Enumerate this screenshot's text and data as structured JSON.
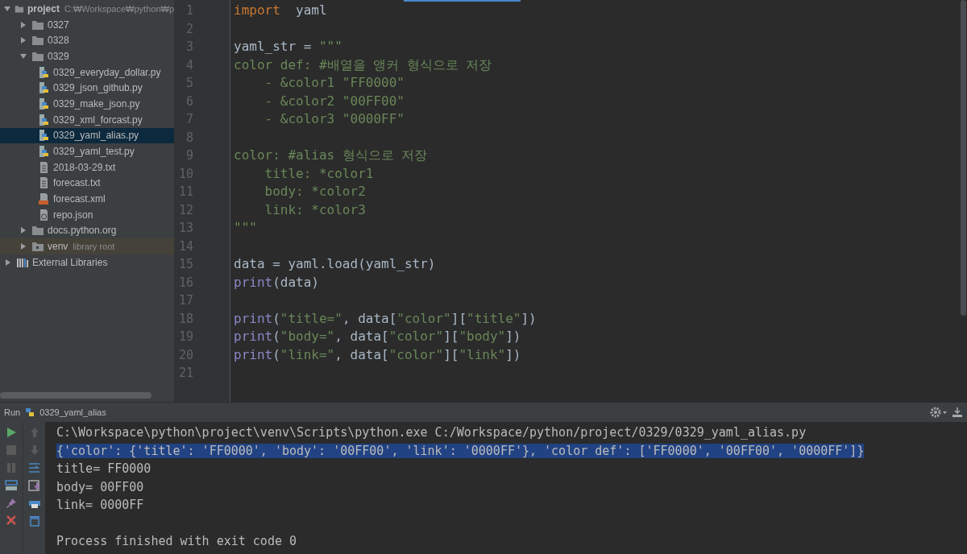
{
  "project_tree": [
    {
      "label": "project",
      "hint": "C:₩Workspace₩python₩p",
      "kind": "folder",
      "expanded": true,
      "selected": false,
      "children": [
        {
          "label": "0327",
          "kind": "folder",
          "expanded": false,
          "selected": false
        },
        {
          "label": "0328",
          "kind": "folder",
          "expanded": false,
          "selected": false
        },
        {
          "label": "0329",
          "kind": "folder",
          "expanded": true,
          "selected": false,
          "children": [
            {
              "label": "0329_everyday_dollar.py",
              "kind": "python",
              "selected": false
            },
            {
              "label": "0329_json_github.py",
              "kind": "python",
              "selected": false
            },
            {
              "label": "0329_make_json.py",
              "kind": "python",
              "selected": false
            },
            {
              "label": "0329_xml_forcast.py",
              "kind": "python",
              "selected": false
            },
            {
              "label": "0329_yaml_alias.py",
              "kind": "python",
              "selected": true
            },
            {
              "label": "0329_yaml_test.py",
              "kind": "python",
              "selected": false
            },
            {
              "label": "2018-03-29.txt",
              "kind": "text",
              "selected": false
            },
            {
              "label": "forecast.txt",
              "kind": "text",
              "selected": false
            },
            {
              "label": "forecast.xml",
              "kind": "xml",
              "selected": false
            },
            {
              "label": "repo.json",
              "kind": "json",
              "selected": false
            }
          ]
        },
        {
          "label": "docs.python.org",
          "kind": "folder",
          "expanded": false,
          "selected": false
        },
        {
          "label": "venv",
          "hint": "library root",
          "kind": "venv",
          "expanded": false,
          "selected": false
        }
      ]
    },
    {
      "label": "External Libraries",
      "kind": "libraries",
      "expanded": false,
      "selected": false
    }
  ],
  "editor": {
    "lines": [
      {
        "number": "1",
        "segments": [
          {
            "kind": "keyword",
            "text": "import"
          },
          {
            "kind": "plain",
            "text": "  yaml"
          }
        ]
      },
      {
        "number": "2"
      },
      {
        "number": "3",
        "segments": [
          {
            "kind": "plain",
            "text": "yaml_str = "
          },
          {
            "kind": "string",
            "text": "\"\"\""
          }
        ]
      },
      {
        "number": "4",
        "segments": [
          {
            "kind": "string",
            "text": "color def: #배열을 앵커 형식으로 저장"
          }
        ]
      },
      {
        "number": "5",
        "segments": [
          {
            "kind": "string",
            "text": "    - &color1 \"FF0000\""
          }
        ]
      },
      {
        "number": "6",
        "segments": [
          {
            "kind": "string",
            "text": "    - &color2 \"00FF00\""
          }
        ]
      },
      {
        "number": "7",
        "segments": [
          {
            "kind": "string",
            "text": "    - &color3 \"0000FF\""
          }
        ]
      },
      {
        "number": "8"
      },
      {
        "number": "9",
        "segments": [
          {
            "kind": "string",
            "text": "color: #alias 형식으로 저장"
          }
        ]
      },
      {
        "number": "10",
        "segments": [
          {
            "kind": "string",
            "text": "    title: *color1"
          }
        ]
      },
      {
        "number": "11",
        "segments": [
          {
            "kind": "string",
            "text": "    body: *color2"
          }
        ]
      },
      {
        "number": "12",
        "segments": [
          {
            "kind": "string",
            "text": "    link: *color3"
          }
        ]
      },
      {
        "number": "13",
        "segments": [
          {
            "kind": "string",
            "text": "\"\"\""
          }
        ]
      },
      {
        "number": "14"
      },
      {
        "number": "15",
        "segments": [
          {
            "kind": "plain",
            "text": "data = yaml.load(yaml_str)"
          }
        ]
      },
      {
        "number": "16",
        "segments": [
          {
            "kind": "builtin",
            "text": "print"
          },
          {
            "kind": "plain",
            "text": "(data)"
          }
        ]
      },
      {
        "number": "17"
      },
      {
        "number": "18",
        "segments": [
          {
            "kind": "builtin",
            "text": "print"
          },
          {
            "kind": "plain",
            "text": "("
          },
          {
            "kind": "string",
            "text": "\"title=\""
          },
          {
            "kind": "plain",
            "text": ", data["
          },
          {
            "kind": "string",
            "text": "\"color\""
          },
          {
            "kind": "plain",
            "text": "]["
          },
          {
            "kind": "string",
            "text": "\"title\""
          },
          {
            "kind": "plain",
            "text": "])"
          }
        ]
      },
      {
        "number": "19",
        "segments": [
          {
            "kind": "builtin",
            "text": "print"
          },
          {
            "kind": "plain",
            "text": "("
          },
          {
            "kind": "string",
            "text": "\"body=\""
          },
          {
            "kind": "plain",
            "text": ", data["
          },
          {
            "kind": "string",
            "text": "\"color\""
          },
          {
            "kind": "plain",
            "text": "]["
          },
          {
            "kind": "string",
            "text": "\"body\""
          },
          {
            "kind": "plain",
            "text": "])"
          }
        ]
      },
      {
        "number": "20",
        "segments": [
          {
            "kind": "builtin",
            "text": "print"
          },
          {
            "kind": "plain",
            "text": "("
          },
          {
            "kind": "string",
            "text": "\"link=\""
          },
          {
            "kind": "plain",
            "text": ", data["
          },
          {
            "kind": "string",
            "text": "\"color\""
          },
          {
            "kind": "plain",
            "text": "]["
          },
          {
            "kind": "string",
            "text": "\"link\""
          },
          {
            "kind": "plain",
            "text": "])"
          }
        ]
      },
      {
        "number": "21"
      }
    ]
  },
  "run_panel": {
    "label": "Run",
    "config": "0329_yaml_alias",
    "lines": [
      {
        "text": "C:\\Workspace\\python\\project\\venv\\Scripts\\python.exe C:/Workspace/python/project/0329/0329_yaml_alias.py",
        "selected": false
      },
      {
        "text": "{'color': {'title': 'FF0000', 'body': '00FF00', 'link': '0000FF'}, 'color def': ['FF0000', '00FF00', '0000FF']}",
        "selected": true
      },
      {
        "text": "title= FF0000",
        "selected": false
      },
      {
        "text": "body= 00FF00",
        "selected": false
      },
      {
        "text": "link= 0000FF",
        "selected": false
      }
    ],
    "exit_message": {
      "text": "Process finished with exit code 0",
      "selected": false
    }
  }
}
